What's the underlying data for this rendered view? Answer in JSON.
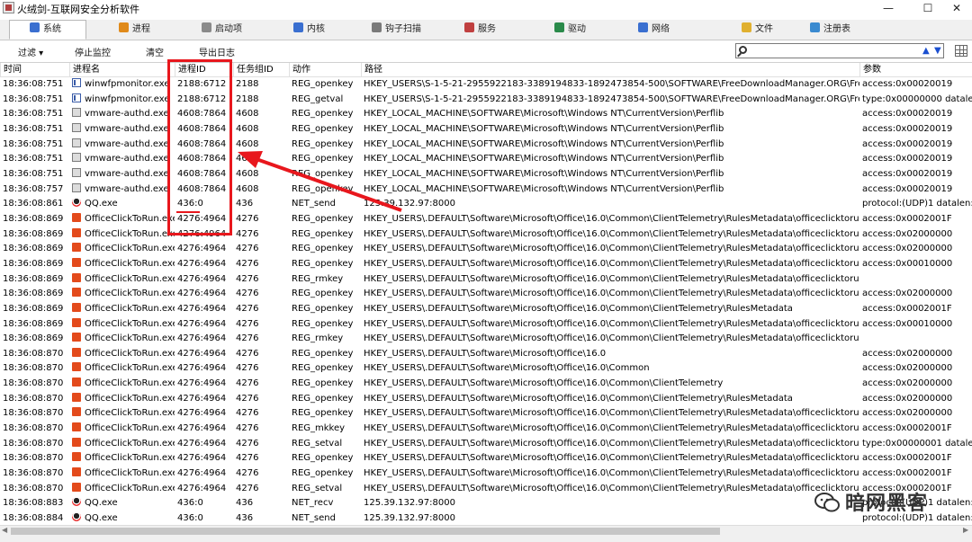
{
  "window": {
    "title": "火绒剑-互联网安全分析软件"
  },
  "tabs": [
    {
      "label": "系统",
      "color": "#3a6fd0",
      "active": true
    },
    {
      "label": "进程",
      "color": "#e08a1a",
      "active": false
    },
    {
      "label": "启动项",
      "color": "#8a8a8a",
      "active": false
    },
    {
      "label": "内核",
      "color": "#3a6fd0",
      "active": false
    },
    {
      "label": "钩子扫描",
      "color": "#7a7a7a",
      "active": false
    },
    {
      "label": "服务",
      "color": "#c04040",
      "active": false
    },
    {
      "label": "驱动",
      "color": "#2a8a4a",
      "active": false
    },
    {
      "label": "网络",
      "color": "#3a6fd0",
      "active": false
    },
    {
      "label": "文件",
      "color": "#e0b030",
      "active": false
    },
    {
      "label": "注册表",
      "color": "#3a8ad0",
      "active": false
    }
  ],
  "toolbar": {
    "filter": "过滤 ▾",
    "stop_monitor": "停止监控",
    "clear": "清空",
    "export_log": "导出日志",
    "search_value": ""
  },
  "columns": [
    "时间",
    "进程名",
    "进程ID",
    "任务组ID",
    "动作",
    "路径",
    "参数"
  ],
  "rows": [
    {
      "time": "18:36:08:751",
      "icon": "win",
      "proc": "winwfpmonitor.exe",
      "pid": "2188:6712",
      "tgid": "2188",
      "action": "REG_openkey",
      "path": "HKEY_USERS\\S-1-5-21-2955922183-3389194833-1892473854-500\\SOFTWARE\\FreeDownloadManager.ORG\\Free Dow...",
      "param": "access:0x00020019"
    },
    {
      "time": "18:36:08:751",
      "icon": "win",
      "proc": "winwfpmonitor.exe",
      "pid": "2188:6712",
      "tgid": "2188",
      "action": "REG_getval",
      "path": "HKEY_USERS\\S-1-5-21-2955922183-3389194833-1892473854-500\\SOFTWARE\\FreeDownloadManager.ORG\\Free Dow...",
      "param": "type:0x00000000 datalen"
    },
    {
      "time": "18:36:08:751",
      "icon": "vm",
      "proc": "vmware-authd.exe",
      "pid": "4608:7864",
      "tgid": "4608",
      "action": "REG_openkey",
      "path": "HKEY_LOCAL_MACHINE\\SOFTWARE\\Microsoft\\Windows NT\\CurrentVersion\\Perflib",
      "param": "access:0x00020019"
    },
    {
      "time": "18:36:08:751",
      "icon": "vm",
      "proc": "vmware-authd.exe",
      "pid": "4608:7864",
      "tgid": "4608",
      "action": "REG_openkey",
      "path": "HKEY_LOCAL_MACHINE\\SOFTWARE\\Microsoft\\Windows NT\\CurrentVersion\\Perflib",
      "param": "access:0x00020019"
    },
    {
      "time": "18:36:08:751",
      "icon": "vm",
      "proc": "vmware-authd.exe",
      "pid": "4608:7864",
      "tgid": "4608",
      "action": "REG_openkey",
      "path": "HKEY_LOCAL_MACHINE\\SOFTWARE\\Microsoft\\Windows NT\\CurrentVersion\\Perflib",
      "param": "access:0x00020019"
    },
    {
      "time": "18:36:08:751",
      "icon": "vm",
      "proc": "vmware-authd.exe",
      "pid": "4608:7864",
      "tgid": "4608",
      "action": "REG_openkey",
      "path": "HKEY_LOCAL_MACHINE\\SOFTWARE\\Microsoft\\Windows NT\\CurrentVersion\\Perflib",
      "param": "access:0x00020019"
    },
    {
      "time": "18:36:08:751",
      "icon": "vm",
      "proc": "vmware-authd.exe",
      "pid": "4608:7864",
      "tgid": "4608",
      "action": "REG_openkey",
      "path": "HKEY_LOCAL_MACHINE\\SOFTWARE\\Microsoft\\Windows NT\\CurrentVersion\\Perflib",
      "param": "access:0x00020019"
    },
    {
      "time": "18:36:08:757",
      "icon": "vm",
      "proc": "vmware-authd.exe",
      "pid": "4608:7864",
      "tgid": "4608",
      "action": "REG_openkey",
      "path": "HKEY_LOCAL_MACHINE\\SOFTWARE\\Microsoft\\Windows NT\\CurrentVersion\\Perflib",
      "param": "access:0x00020019"
    },
    {
      "time": "18:36:08:861",
      "icon": "qq",
      "proc": "QQ.exe",
      "pid": "436:0",
      "tgid": "436",
      "action": "NET_send",
      "path": "125.39.132.97:8000",
      "param": "protocol:(UDP)1 datalen:4"
    },
    {
      "time": "18:36:08:869",
      "icon": "office",
      "proc": "OfficeClickToRun.exe",
      "pid": "4276:4964",
      "tgid": "4276",
      "action": "REG_openkey",
      "path": "HKEY_USERS\\.DEFAULT\\Software\\Microsoft\\Office\\16.0\\Common\\ClientTelemetry\\RulesMetadata\\officeclicktorun.exe",
      "param": "access:0x0002001F"
    },
    {
      "time": "18:36:08:869",
      "icon": "office",
      "proc": "OfficeClickToRun.exe",
      "pid": "4276:4964",
      "tgid": "4276",
      "action": "REG_openkey",
      "path": "HKEY_USERS\\.DEFAULT\\Software\\Microsoft\\Office\\16.0\\Common\\ClientTelemetry\\RulesMetadata\\officeclicktorun.exe\\...",
      "param": "access:0x02000000"
    },
    {
      "time": "18:36:08:869",
      "icon": "office",
      "proc": "OfficeClickToRun.exe",
      "pid": "4276:4964",
      "tgid": "4276",
      "action": "REG_openkey",
      "path": "HKEY_USERS\\.DEFAULT\\Software\\Microsoft\\Office\\16.0\\Common\\ClientTelemetry\\RulesMetadata\\officeclicktorun.exe\\...",
      "param": "access:0x02000000"
    },
    {
      "time": "18:36:08:869",
      "icon": "office",
      "proc": "OfficeClickToRun.exe",
      "pid": "4276:4964",
      "tgid": "4276",
      "action": "REG_openkey",
      "path": "HKEY_USERS\\.DEFAULT\\Software\\Microsoft\\Office\\16.0\\Common\\ClientTelemetry\\RulesMetadata\\officeclicktorun.exe\\...",
      "param": "access:0x00010000"
    },
    {
      "time": "18:36:08:869",
      "icon": "office",
      "proc": "OfficeClickToRun.exe",
      "pid": "4276:4964",
      "tgid": "4276",
      "action": "REG_rmkey",
      "path": "HKEY_USERS\\.DEFAULT\\Software\\Microsoft\\Office\\16.0\\Common\\ClientTelemetry\\RulesMetadata\\officeclicktorun.exe\\...",
      "param": ""
    },
    {
      "time": "18:36:08:869",
      "icon": "office",
      "proc": "OfficeClickToRun.exe",
      "pid": "4276:4964",
      "tgid": "4276",
      "action": "REG_openkey",
      "path": "HKEY_USERS\\.DEFAULT\\Software\\Microsoft\\Office\\16.0\\Common\\ClientTelemetry\\RulesMetadata\\officeclicktorun.exe",
      "param": "access:0x02000000"
    },
    {
      "time": "18:36:08:869",
      "icon": "office",
      "proc": "OfficeClickToRun.exe",
      "pid": "4276:4964",
      "tgid": "4276",
      "action": "REG_openkey",
      "path": "HKEY_USERS\\.DEFAULT\\Software\\Microsoft\\Office\\16.0\\Common\\ClientTelemetry\\RulesMetadata",
      "param": "access:0x0002001F"
    },
    {
      "time": "18:36:08:869",
      "icon": "office",
      "proc": "OfficeClickToRun.exe",
      "pid": "4276:4964",
      "tgid": "4276",
      "action": "REG_openkey",
      "path": "HKEY_USERS\\.DEFAULT\\Software\\Microsoft\\Office\\16.0\\Common\\ClientTelemetry\\RulesMetadata\\officeclicktorun.exe",
      "param": "access:0x00010000"
    },
    {
      "time": "18:36:08:869",
      "icon": "office",
      "proc": "OfficeClickToRun.exe",
      "pid": "4276:4964",
      "tgid": "4276",
      "action": "REG_rmkey",
      "path": "HKEY_USERS\\.DEFAULT\\Software\\Microsoft\\Office\\16.0\\Common\\ClientTelemetry\\RulesMetadata\\officeclicktorun.exe",
      "param": ""
    },
    {
      "time": "18:36:08:870",
      "icon": "office",
      "proc": "OfficeClickToRun.exe",
      "pid": "4276:4964",
      "tgid": "4276",
      "action": "REG_openkey",
      "path": "HKEY_USERS\\.DEFAULT\\Software\\Microsoft\\Office\\16.0",
      "param": "access:0x02000000"
    },
    {
      "time": "18:36:08:870",
      "icon": "office",
      "proc": "OfficeClickToRun.exe",
      "pid": "4276:4964",
      "tgid": "4276",
      "action": "REG_openkey",
      "path": "HKEY_USERS\\.DEFAULT\\Software\\Microsoft\\Office\\16.0\\Common",
      "param": "access:0x02000000"
    },
    {
      "time": "18:36:08:870",
      "icon": "office",
      "proc": "OfficeClickToRun.exe",
      "pid": "4276:4964",
      "tgid": "4276",
      "action": "REG_openkey",
      "path": "HKEY_USERS\\.DEFAULT\\Software\\Microsoft\\Office\\16.0\\Common\\ClientTelemetry",
      "param": "access:0x02000000"
    },
    {
      "time": "18:36:08:870",
      "icon": "office",
      "proc": "OfficeClickToRun.exe",
      "pid": "4276:4964",
      "tgid": "4276",
      "action": "REG_openkey",
      "path": "HKEY_USERS\\.DEFAULT\\Software\\Microsoft\\Office\\16.0\\Common\\ClientTelemetry\\RulesMetadata",
      "param": "access:0x02000000"
    },
    {
      "time": "18:36:08:870",
      "icon": "office",
      "proc": "OfficeClickToRun.exe",
      "pid": "4276:4964",
      "tgid": "4276",
      "action": "REG_openkey",
      "path": "HKEY_USERS\\.DEFAULT\\Software\\Microsoft\\Office\\16.0\\Common\\ClientTelemetry\\RulesMetadata\\officeclicktorun.exe",
      "param": "access:0x02000000"
    },
    {
      "time": "18:36:08:870",
      "icon": "office",
      "proc": "OfficeClickToRun.exe",
      "pid": "4276:4964",
      "tgid": "4276",
      "action": "REG_mkkey",
      "path": "HKEY_USERS\\.DEFAULT\\Software\\Microsoft\\Office\\16.0\\Common\\ClientTelemetry\\RulesMetadata\\officeclicktorun.exe",
      "param": "access:0x0002001F"
    },
    {
      "time": "18:36:08:870",
      "icon": "office",
      "proc": "OfficeClickToRun.exe",
      "pid": "4276:4964",
      "tgid": "4276",
      "action": "REG_setval",
      "path": "HKEY_USERS\\.DEFAULT\\Software\\Microsoft\\Office\\16.0\\Common\\ClientTelemetry\\RulesMetadata\\officeclicktorun.exe\\...",
      "param": "type:0x00000001 datalen"
    },
    {
      "time": "18:36:08:870",
      "icon": "office",
      "proc": "OfficeClickToRun.exe",
      "pid": "4276:4964",
      "tgid": "4276",
      "action": "REG_openkey",
      "path": "HKEY_USERS\\.DEFAULT\\Software\\Microsoft\\Office\\16.0\\Common\\ClientTelemetry\\RulesMetadata\\officeclicktorun.exe\\...",
      "param": "access:0x0002001F"
    },
    {
      "time": "18:36:08:870",
      "icon": "office",
      "proc": "OfficeClickToRun.exe",
      "pid": "4276:4964",
      "tgid": "4276",
      "action": "REG_openkey",
      "path": "HKEY_USERS\\.DEFAULT\\Software\\Microsoft\\Office\\16.0\\Common\\ClientTelemetry\\RulesMetadata\\officeclicktorun.exe\\...",
      "param": "access:0x0002001F"
    },
    {
      "time": "18:36:08:870",
      "icon": "office",
      "proc": "OfficeClickToRun.exe",
      "pid": "4276:4964",
      "tgid": "4276",
      "action": "REG_setval",
      "path": "HKEY_USERS\\.DEFAULT\\Software\\Microsoft\\Office\\16.0\\Common\\ClientTelemetry\\RulesMetadata\\officeclicktorun.exe\\...",
      "param": "access:0x0002001F"
    },
    {
      "time": "18:36:08:883",
      "icon": "qq",
      "proc": "QQ.exe",
      "pid": "436:0",
      "tgid": "436",
      "action": "NET_recv",
      "path": "125.39.132.97:8000",
      "param": "protocol:(UDP)1 datalen:6"
    },
    {
      "time": "18:36:08:884",
      "icon": "qq",
      "proc": "QQ.exe",
      "pid": "436:0",
      "tgid": "436",
      "action": "NET_send",
      "path": "125.39.132.97:8000",
      "param": "protocol:(UDP)1 datalen:"
    }
  ],
  "watermark": {
    "text": "暗网黑客"
  },
  "colors": {
    "highlight": "#e8171d",
    "accent": "#1a4fd0"
  }
}
